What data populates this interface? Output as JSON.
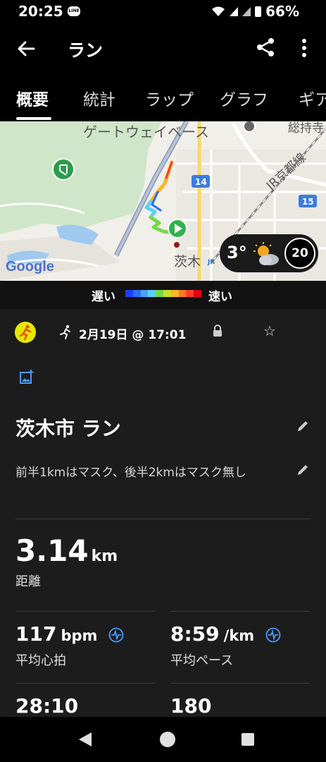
{
  "status_bar": {
    "time": "20:25",
    "battery": "66%"
  },
  "app_bar": {
    "title": "ラン"
  },
  "tabs": [
    {
      "label": "概要",
      "active": true
    },
    {
      "label": "統計"
    },
    {
      "label": "ラップ"
    },
    {
      "label": "グラフ"
    },
    {
      "label": "ギア"
    }
  ],
  "map": {
    "labels": {
      "gateway": "ゲートウェイベース",
      "jr_line": "JR京都線",
      "city": "茨木",
      "jr": "JR",
      "top_right": "総持寺",
      "route14": "14",
      "route15": "15",
      "google": "Google"
    },
    "weather": {
      "temperature": "3°",
      "wind": "20"
    }
  },
  "legend": {
    "slow": "遅い",
    "fast": "速い",
    "colors": [
      "#1e40ff",
      "#2d6cff",
      "#4aa3ff",
      "#5bd0ff",
      "#76d94a",
      "#c8e028",
      "#ffb42a",
      "#ff7a1e",
      "#ff3c2a",
      "#e0001a"
    ]
  },
  "activity": {
    "date": "2月19日 @ 17:01",
    "title": "茨木市 ラン",
    "description": "前半1kmはマスク、後半2kmはマスク無し",
    "distance": {
      "value": "3.14",
      "unit": "km",
      "label": "距離"
    },
    "heart_rate": {
      "value": "117",
      "unit": "bpm",
      "label": "平均心拍"
    },
    "pace": {
      "value": "8:59",
      "unit": "/km",
      "label": "平均ペース"
    },
    "time": {
      "value": "28:10"
    },
    "cadence": {
      "value": "180"
    }
  },
  "colors": {
    "accent_blue": "#4a9bff",
    "activity_yellow": "#e4e800",
    "start_green": "#2fb24c"
  }
}
